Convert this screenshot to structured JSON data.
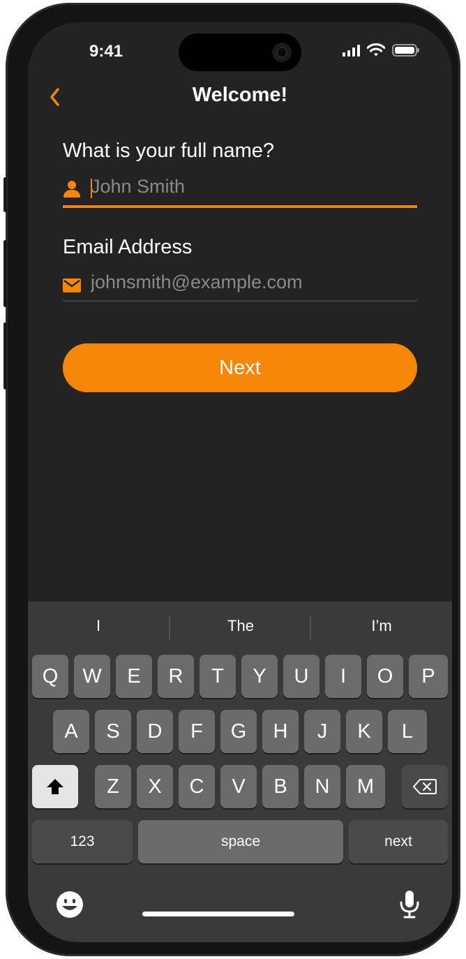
{
  "status_bar": {
    "time": "9:41",
    "icons": [
      "cellular-signal-icon",
      "wifi-icon",
      "battery-icon"
    ]
  },
  "nav": {
    "back_icon": "chevron-left-icon",
    "title": "Welcome!"
  },
  "form": {
    "name": {
      "label": "What is your full name?",
      "placeholder": "John Smith",
      "icon": "person-icon",
      "value": ""
    },
    "email": {
      "label": "Email Address",
      "placeholder": "johnsmith@example.com",
      "icon": "envelope-icon",
      "value": ""
    }
  },
  "next_button": {
    "label": "Next"
  },
  "keyboard": {
    "suggestions": [
      "I",
      "The",
      "I’m"
    ],
    "row1": [
      "Q",
      "W",
      "E",
      "R",
      "T",
      "Y",
      "U",
      "I",
      "O",
      "P"
    ],
    "row2": [
      "A",
      "S",
      "D",
      "F",
      "G",
      "H",
      "J",
      "K",
      "L"
    ],
    "row3": [
      "Z",
      "X",
      "C",
      "V",
      "B",
      "N",
      "M"
    ],
    "numbers_label": "123",
    "space_label": "space",
    "return_label": "next",
    "shift_icon": "shift-arrow-icon",
    "delete_icon": "backspace-icon",
    "emoji_icon": "emoji-icon",
    "mic_icon": "microphone-icon"
  },
  "colors": {
    "accent": "#F58608",
    "background": "#232323",
    "keyboard_background": "#3A3A3A",
    "key": "#6B6B6B",
    "field_underline_inactive": "#3A3A3A"
  }
}
